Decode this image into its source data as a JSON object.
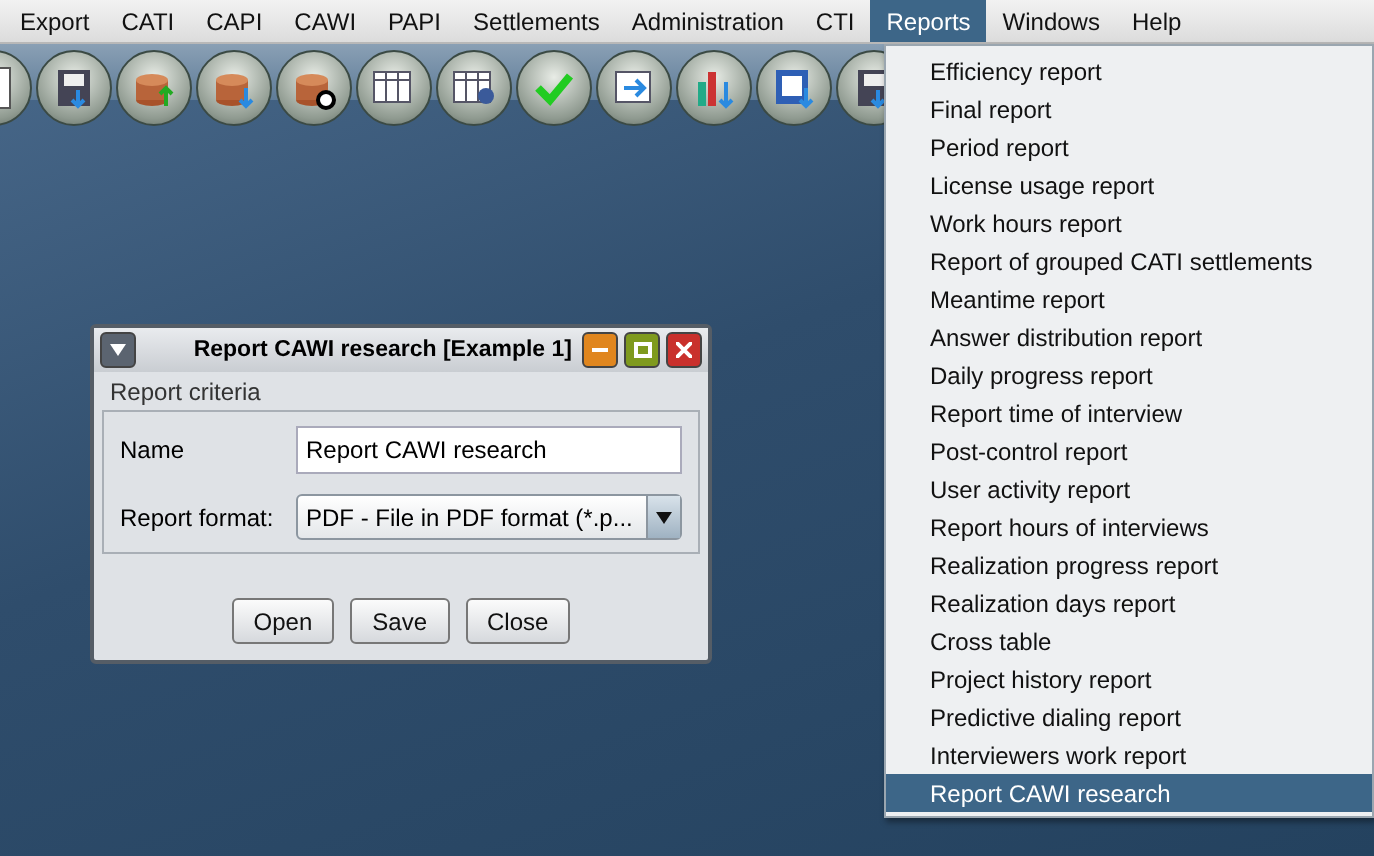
{
  "menu_bar": [
    {
      "label": "Export",
      "selected": false
    },
    {
      "label": "CATI",
      "selected": false
    },
    {
      "label": "CAPI",
      "selected": false
    },
    {
      "label": "CAWI",
      "selected": false
    },
    {
      "label": "PAPI",
      "selected": false
    },
    {
      "label": "Settlements",
      "selected": false
    },
    {
      "label": "Administration",
      "selected": false
    },
    {
      "label": "CTI",
      "selected": false
    },
    {
      "label": "Reports",
      "selected": true
    },
    {
      "label": "Windows",
      "selected": false
    },
    {
      "label": "Help",
      "selected": false
    }
  ],
  "toolbar": [
    {
      "kind": "document"
    },
    {
      "kind": "floppy"
    },
    {
      "kind": "coins-up"
    },
    {
      "kind": "coins-down"
    },
    {
      "kind": "coins-record"
    },
    {
      "kind": "table"
    },
    {
      "kind": "table-user"
    },
    {
      "kind": "check"
    },
    {
      "kind": "document-arrow"
    },
    {
      "kind": "chart"
    },
    {
      "kind": "word"
    },
    {
      "kind": "floppy"
    }
  ],
  "reports_menu": [
    {
      "label": "Efficiency report",
      "selected": false
    },
    {
      "label": "Final report",
      "selected": false
    },
    {
      "label": "Period report",
      "selected": false
    },
    {
      "label": "License usage report",
      "selected": false
    },
    {
      "label": "Work hours report",
      "selected": false
    },
    {
      "label": "Report of grouped CATI settlements",
      "selected": false
    },
    {
      "label": "Meantime report",
      "selected": false
    },
    {
      "label": "Answer distribution report",
      "selected": false
    },
    {
      "label": "Daily progress report",
      "selected": false
    },
    {
      "label": "Report time of interview",
      "selected": false
    },
    {
      "label": "Post-control report",
      "selected": false
    },
    {
      "label": "User activity report",
      "selected": false
    },
    {
      "label": "Report hours of interviews",
      "selected": false
    },
    {
      "label": "Realization progress report",
      "selected": false
    },
    {
      "label": "Realization days report",
      "selected": false
    },
    {
      "label": "Cross table",
      "selected": false
    },
    {
      "label": "Project history report",
      "selected": false
    },
    {
      "label": "Predictive dialing report",
      "selected": false
    },
    {
      "label": "Interviewers work report",
      "selected": false
    },
    {
      "label": "Report CAWI research",
      "selected": true
    }
  ],
  "dialog": {
    "title": "Report CAWI research [Example 1]",
    "section": "Report criteria",
    "name_label": "Name",
    "name_value": "Report CAWI research",
    "format_label": "Report format:",
    "format_value": "PDF - File in PDF format (*.p...",
    "buttons": [
      "Open",
      "Save",
      "Close"
    ]
  }
}
